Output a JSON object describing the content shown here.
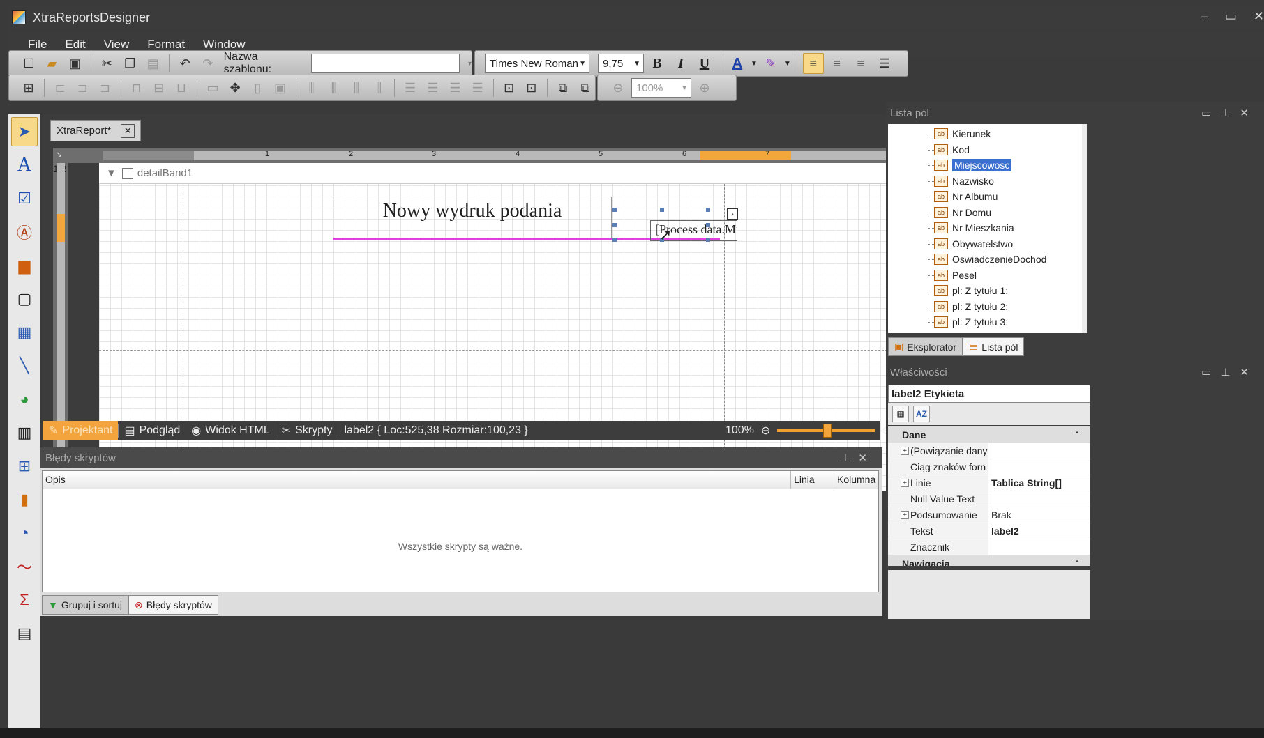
{
  "window": {
    "title": "XtraReportsDesigner"
  },
  "menu": [
    "File",
    "Edit",
    "View",
    "Format",
    "Window"
  ],
  "toolbar": {
    "template_label": "Nazwa szablonu:",
    "template_value": "",
    "font_name": "Times New Roman",
    "font_size": "9,75",
    "bold": "B",
    "italic": "I",
    "underline": "U",
    "font_color": "A",
    "zoom_value": "100%"
  },
  "document": {
    "tab_label": "XtraReport*",
    "band_name": "detailBand1",
    "title_text": "Nowy wydruk podania",
    "label_text": "[Process data.Mi",
    "ruler_numbers": [
      "1",
      "2",
      "3",
      "4",
      "5",
      "6",
      "7"
    ],
    "vruler_numbers": [
      "1",
      "2"
    ]
  },
  "statusbar": {
    "designer": "Projektant",
    "preview": "Podgląd",
    "html_view": "Widok HTML",
    "scripts": "Skrypty",
    "selection_info": "label2 { Loc:525,38 Rozmiar:100,23 }",
    "zoom": "100%"
  },
  "errors_panel": {
    "title": "Błędy skryptów",
    "columns": [
      "Opis",
      "Linia",
      "Kolumna"
    ],
    "empty_message": "Wszystkie skrypty są ważne.",
    "tabs": [
      "Grupuj i sortuj",
      "Błędy skryptów"
    ]
  },
  "field_list": {
    "title": "Lista pól",
    "items": [
      "Kierunek",
      "Kod",
      "Miejscowosc",
      "Nazwisko",
      "Nr Albumu",
      "Nr Domu",
      "Nr Mieszkania",
      "Obywatelstwo",
      "OswiadczenieDochod",
      "Pesel",
      "pl: Z tytułu 1:",
      "pl: Z tytułu 2:",
      "pl: Z tytułu 3:"
    ],
    "selected": "Miejscowosc",
    "tabs": [
      "Eksplorator",
      "Lista pól"
    ]
  },
  "properties": {
    "title": "Właściwości",
    "selected_object": "label2  Etykieta",
    "categories": [
      {
        "name": "Dane",
        "rows": [
          {
            "name": "(Powiązanie dany",
            "value": "",
            "expand": true,
            "bold": false
          },
          {
            "name": "Ciąg znaków forn",
            "value": "",
            "expand": false,
            "bold": false
          },
          {
            "name": "Linie",
            "value": "Tablica String[]",
            "expand": true,
            "bold": true
          },
          {
            "name": "Null Value Text",
            "value": "",
            "expand": false,
            "bold": false
          },
          {
            "name": "Podsumowanie",
            "value": "Brak",
            "expand": true,
            "bold": false
          },
          {
            "name": "Tekst",
            "value": "label2",
            "expand": false,
            "bold": true
          },
          {
            "name": "Znacznik",
            "value": "",
            "expand": false,
            "bold": false
          }
        ]
      },
      {
        "name": "Nawigacja",
        "rows": []
      }
    ]
  },
  "colors": {
    "accent": "#f3a43c",
    "selection": "#3b6fd0",
    "magenta_guide": "#e040e0"
  }
}
